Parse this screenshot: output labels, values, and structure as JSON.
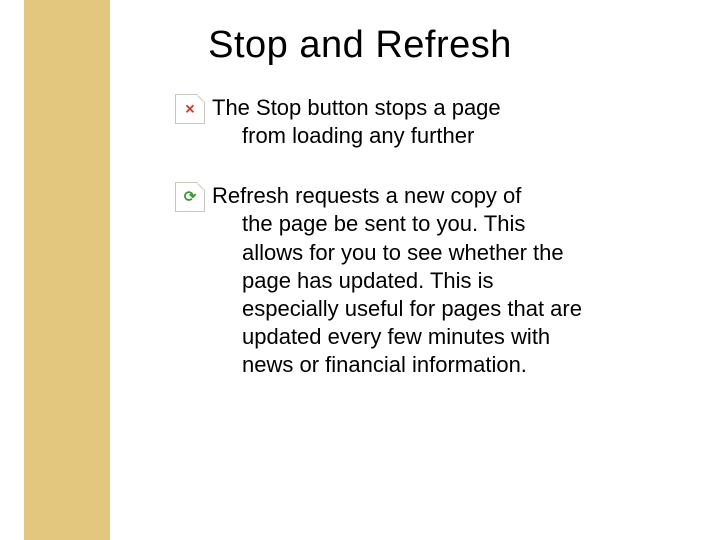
{
  "title": "Stop and Refresh",
  "items": [
    {
      "icon": "stop-icon",
      "first_line": "The Stop button stops a page",
      "rest": "from loading any further"
    },
    {
      "icon": "refresh-icon",
      "first_line": "Refresh requests a new copy of",
      "rest": "the page be sent to you. This allows for you to see whether the page has updated.  This is especially useful for pages that are updated every few minutes with news or financial information."
    }
  ]
}
